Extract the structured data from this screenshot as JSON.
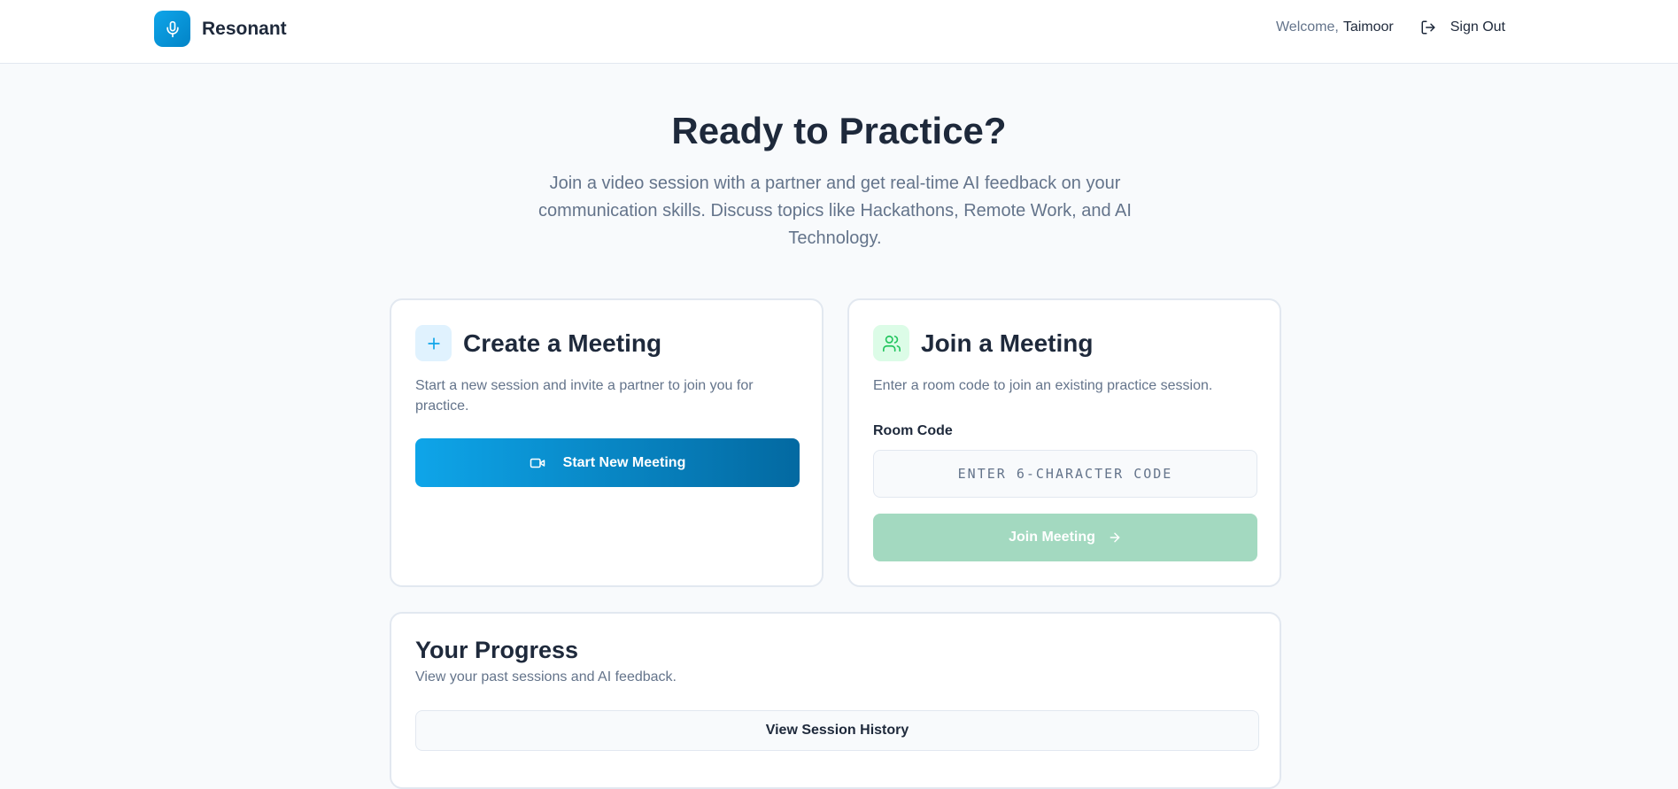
{
  "header": {
    "brand_name": "Resonant",
    "welcome_prefix": "Welcome,",
    "user_name": "Taimoor",
    "sign_out_label": "Sign Out"
  },
  "hero": {
    "title": "Ready to Practice?",
    "subtitle": "Join a video session with a partner and get real-time AI feedback on your communication skills. Discuss topics like Hackathons, Remote Work, and AI Technology."
  },
  "create_card": {
    "title": "Create a Meeting",
    "description": "Start a new session and invite a partner to join you for practice.",
    "button_label": "Start New Meeting",
    "icon": "plus-icon"
  },
  "join_card": {
    "title": "Join a Meeting",
    "description": "Enter a room code to join an existing practice session.",
    "field_label": "Room Code",
    "input_placeholder": "ENTER 6-CHARACTER CODE",
    "input_value": "",
    "button_label": "Join Meeting",
    "icon": "users-icon"
  },
  "progress_card": {
    "title": "Your Progress",
    "description": "View your past sessions and AI feedback.",
    "button_label": "View Session History"
  },
  "colors": {
    "brand": "#0ea5e9",
    "brand_dark": "#0369a1",
    "join_disabled": "#a3d9c0",
    "text_dark": "#1e293b",
    "text_muted": "#64748b"
  }
}
